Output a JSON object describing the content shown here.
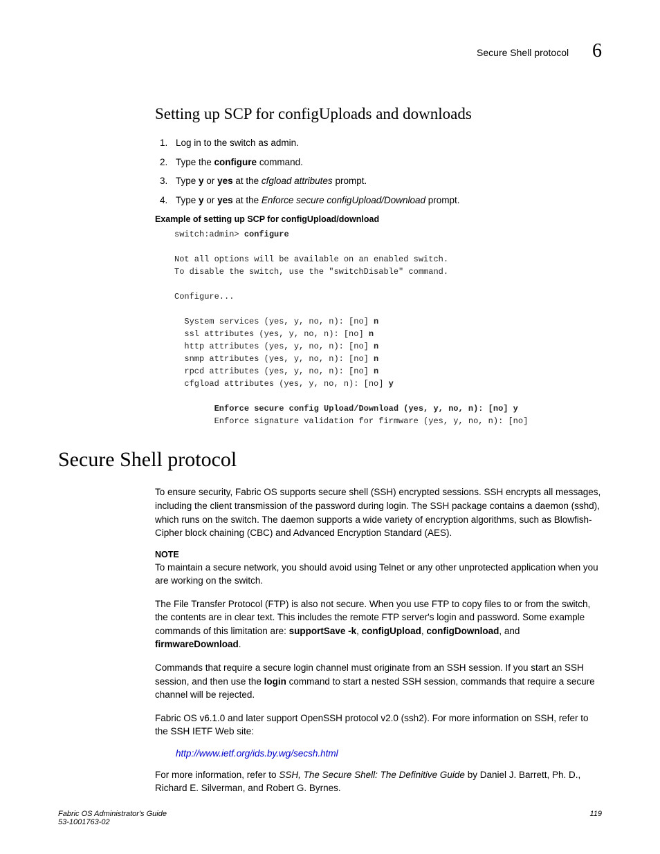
{
  "header": {
    "sectionTitle": "Secure Shell protocol",
    "chapterNumber": "6"
  },
  "h2": "Setting up SCP for configUploads and downloads",
  "steps": {
    "s1": "Log in to the switch as admin.",
    "s2a": "Type the ",
    "s2b": "configure",
    "s2c": " command.",
    "s3a": "Type ",
    "s3b": "y",
    "s3c": " or ",
    "s3d": "yes",
    "s3e": " at the ",
    "s3f": "cfgload attributes",
    "s3g": " prompt.",
    "s4a": "Type ",
    "s4b": "y",
    "s4c": " or ",
    "s4d": "yes",
    "s4e": " at the ",
    "s4f": "Enforce secure configUpload/Download",
    "s4g": " prompt."
  },
  "exampleHeading": "Example  of setting up SCP for configUpload/download",
  "code": {
    "l1a": "switch:admin> ",
    "l1b": "configure",
    "l2": "Not all options will be available on an enabled switch.",
    "l3": "To disable the switch, use the \"switchDisable\" command.",
    "l4": "Configure...",
    "l5a": "  System services (yes, y, no, n): [no] ",
    "l5b": "n",
    "l6a": "  ssl attributes (yes, y, no, n): [no] ",
    "l6b": "n",
    "l7a": "  http attributes (yes, y, no, n): [no] ",
    "l7b": "n",
    "l8a": "  snmp attributes (yes, y, no, n): [no] ",
    "l8b": "n",
    "l9a": "  rpcd attributes (yes, y, no, n): [no] ",
    "l9b": "n",
    "l10a": "  cfgload attributes (yes, y, no, n): [no] ",
    "l10b": "y",
    "l11": "        Enforce secure config Upload/Download (yes, y, no, n): [no] y",
    "l12": "        Enforce signature validation for firmware (yes, y, no, n): [no]"
  },
  "h1": "Secure Shell protocol",
  "p1": "To ensure security, Fabric OS supports secure shell (SSH) encrypted sessions. SSH encrypts all messages, including the client transmission of the password during login. The SSH package contains a daemon (sshd), which runs on the switch. The daemon supports a wide variety of encryption algorithms, such as Blowfish-Cipher block chaining (CBC) and Advanced Encryption Standard (AES).",
  "noteLabel": "NOTE",
  "p2": "To maintain a secure network, you should avoid using Telnet or any other unprotected application when you are working on the switch.",
  "p3a": "The File Transfer Protocol (FTP) is also not secure. When you use FTP to copy files to or from the switch, the contents are in clear text. This includes the remote FTP server's login and password. Some example commands of this limitation are: ",
  "p3b": "supportSave -k",
  "p3c": ", ",
  "p3d": "configUpload",
  "p3e": ", ",
  "p3f": "configDownload",
  "p3g": ", and ",
  "p3h": "firmwareDownload",
  "p3i": ".",
  "p4a": "Commands that require a secure login channel must originate from an SSH session. If you start an SSH session, and then use the ",
  "p4b": "login",
  "p4c": " command to start a nested SSH session, commands that require a secure channel will be rejected.",
  "p5": "Fabric OS v6.1.0 and later support OpenSSH protocol v2.0 (ssh2). For more information on SSH, refer to the SSH IETF Web site:",
  "link": "http://www.ietf.org/ids.by.wg/secsh.html",
  "p6a": "For more information, refer to ",
  "p6b": "SSH, The Secure Shell: The Definitive Guide",
  "p6c": " by Daniel J. Barrett, Ph. D., Richard E. Silverman, and Robert G. Byrnes.",
  "footer": {
    "title": "Fabric OS Administrator's Guide",
    "doc": "53-1001763-02",
    "page": "119"
  }
}
